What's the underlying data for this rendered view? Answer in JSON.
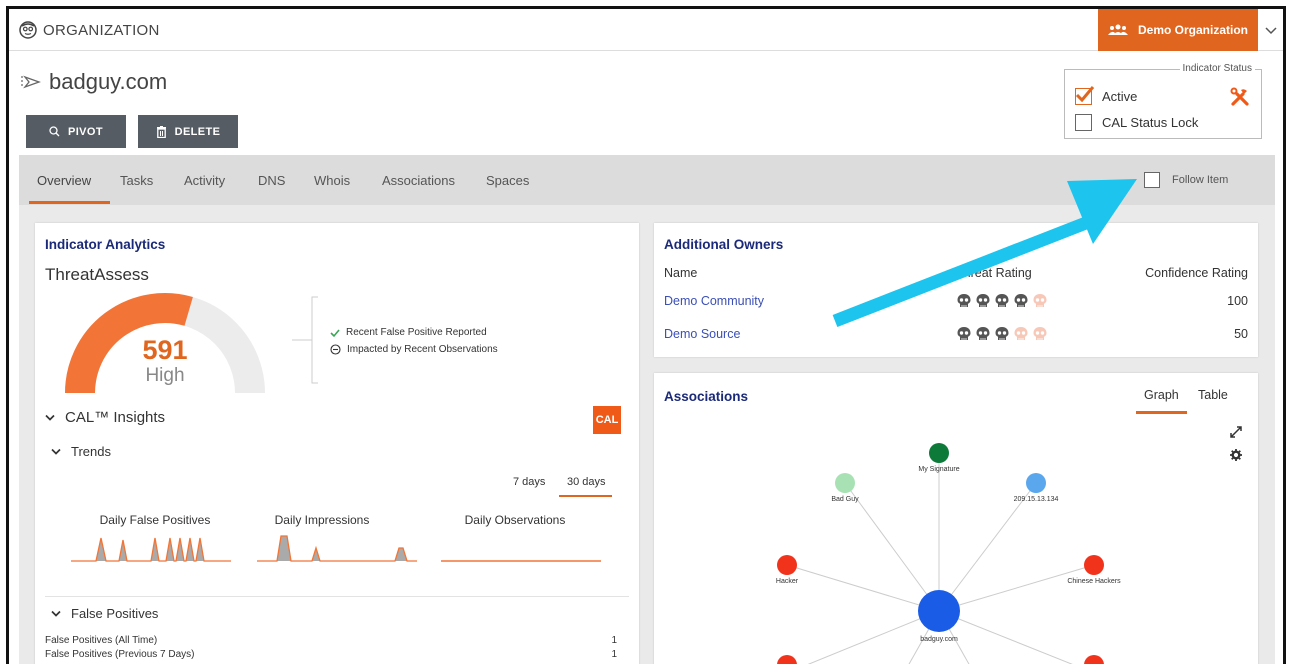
{
  "header": {
    "org_title": "ORGANIZATION",
    "org_button": "Demo Organization"
  },
  "indicator": {
    "title": "badguy.com",
    "pivot_label": "PIVOT",
    "delete_label": "DELETE"
  },
  "status": {
    "legend": "Indicator Status",
    "active_label": "Active",
    "active_checked": true,
    "cal_lock_label": "CAL Status Lock",
    "cal_lock_checked": false
  },
  "tabs": [
    "Overview",
    "Tasks",
    "Activity",
    "DNS",
    "Whois",
    "Associations",
    "Spaces"
  ],
  "follow_label": "Follow Item",
  "analytics": {
    "title": "Indicator Analytics",
    "threat_assess_label": "ThreatAssess",
    "score": "591",
    "score_fraction": 0.59,
    "score_level": "High",
    "flags": [
      "Recent False Positive Reported",
      "Impacted by Recent Observations"
    ],
    "cal_insights": "CAL™ Insights",
    "cal_badge": "CAL",
    "trends": "Trends",
    "ranges": [
      "7 days",
      "30 days"
    ],
    "spark_labels": [
      "Daily False Positives",
      "Daily Impressions",
      "Daily Observations"
    ],
    "false_positives": "False Positives",
    "fp_rows": [
      {
        "label": "False Positives (All Time)",
        "value": "1"
      },
      {
        "label": "False Positives (Previous 7 Days)",
        "value": "1"
      }
    ]
  },
  "owners": {
    "title": "Additional Owners",
    "columns": [
      "Name",
      "Threat Rating",
      "Confidence Rating"
    ],
    "rows": [
      {
        "name": "Demo Community",
        "threat_rating": 4,
        "confidence": "100"
      },
      {
        "name": "Demo Source",
        "threat_rating": 3,
        "confidence": "50"
      }
    ]
  },
  "associations": {
    "title": "Associations",
    "tabs": [
      "Graph",
      "Table"
    ],
    "nodes": {
      "my_signature": "My Signature",
      "bad_guy": "Bad Guy",
      "ip": "209.15.13.134",
      "hacker": "Hacker",
      "chinese_hackers": "Chinese Hackers",
      "center": "badguy.com"
    }
  },
  "colors": {
    "accent": "#e0661f",
    "link": "#3b4fb5",
    "title": "#1b2a78",
    "arrow": "#1cc4ee"
  }
}
